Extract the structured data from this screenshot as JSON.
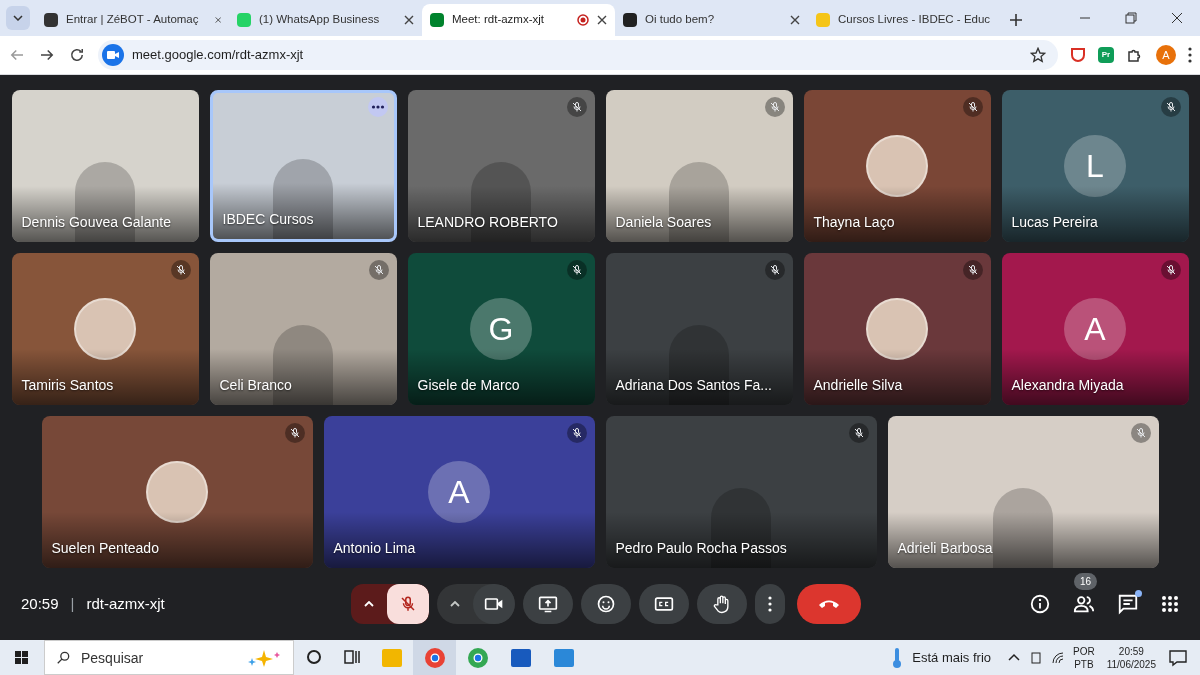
{
  "browser": {
    "tabs": [
      {
        "title": "Entrar | ZéBOT - Automaç",
        "selected": false,
        "recording": false
      },
      {
        "title": "(1) WhatsApp Business",
        "selected": false,
        "recording": false
      },
      {
        "title": "Meet: rdt-azmx-xjt",
        "selected": true,
        "recording": true
      },
      {
        "title": "Oi tudo bem?",
        "selected": false,
        "recording": false
      },
      {
        "title": "Cursos Livres - IBDEC - Educ",
        "selected": false,
        "recording": false
      }
    ],
    "url": "meet.google.com/rdt-azmx-xjt",
    "profile_initial": "A",
    "extension_label": "Pr"
  },
  "tile_rows": [
    {
      "tiles": [
        {
          "name": "Dennis Gouvea Galante",
          "kind": "video",
          "muted": false,
          "speaking": false,
          "color": "#d6d3cc"
        },
        {
          "name": "IBDEC Cursos",
          "kind": "video",
          "muted": false,
          "speaking": true,
          "color": "#c8ced6"
        },
        {
          "name": "LEANDRO ROBERTO",
          "kind": "video",
          "muted": true,
          "speaking": false,
          "color": "#6a6a6a"
        },
        {
          "name": "Daniela Soares",
          "kind": "video",
          "muted": true,
          "speaking": false,
          "color": "#d2ccc2"
        },
        {
          "name": "Thayna Laço",
          "kind": "avatar",
          "muted": true,
          "speaking": false,
          "color": "#7a4636"
        },
        {
          "name": "Lucas Pereira",
          "kind": "letter",
          "letter": "L",
          "muted": true,
          "speaking": false,
          "color": "#3d5e69"
        }
      ]
    },
    {
      "tiles": [
        {
          "name": "Tamiris Santos",
          "kind": "avatar",
          "muted": true,
          "speaking": false,
          "color": "#87553a"
        },
        {
          "name": "Celi Branco",
          "kind": "video",
          "muted": true,
          "speaking": false,
          "color": "#b3aaa0"
        },
        {
          "name": "Gisele de Marco",
          "kind": "letter",
          "letter": "G",
          "muted": true,
          "speaking": false,
          "color": "#0f4b3b"
        },
        {
          "name": "Adriana Dos Santos Fa...",
          "kind": "video",
          "muted": true,
          "speaking": false,
          "color": "#3c4043"
        },
        {
          "name": "Andrielle Silva",
          "kind": "avatar",
          "muted": true,
          "speaking": false,
          "color": "#6a383b"
        },
        {
          "name": "Alexandra Miyada",
          "kind": "letter",
          "letter": "A",
          "muted": true,
          "speaking": false,
          "color": "#a3184d"
        }
      ]
    },
    {
      "tiles": [
        {
          "name": "Suelen Penteado",
          "kind": "avatar",
          "muted": true,
          "speaking": false,
          "color": "#774838"
        },
        {
          "name": "Antonio Lima",
          "kind": "letter",
          "letter": "A",
          "muted": true,
          "speaking": false,
          "color": "#3b409a"
        },
        {
          "name": "Pedro Paulo Rocha Passos",
          "kind": "video",
          "muted": true,
          "speaking": false,
          "color": "#3c4043"
        },
        {
          "name": "Adrieli Barbosa",
          "kind": "video",
          "muted": true,
          "speaking": false,
          "color": "#d6cec6"
        }
      ]
    }
  ],
  "meeting": {
    "time": "20:59",
    "separator": "|",
    "code": "rdt-azmx-xjt",
    "mic_on": false,
    "participants_count": "16",
    "chat_unread": true
  },
  "taskbar": {
    "search_placeholder": "Pesquisar",
    "weather": "Está mais frio",
    "language": "POR",
    "layout": "PTB",
    "time": "20:59",
    "date": "11/06/2025"
  }
}
